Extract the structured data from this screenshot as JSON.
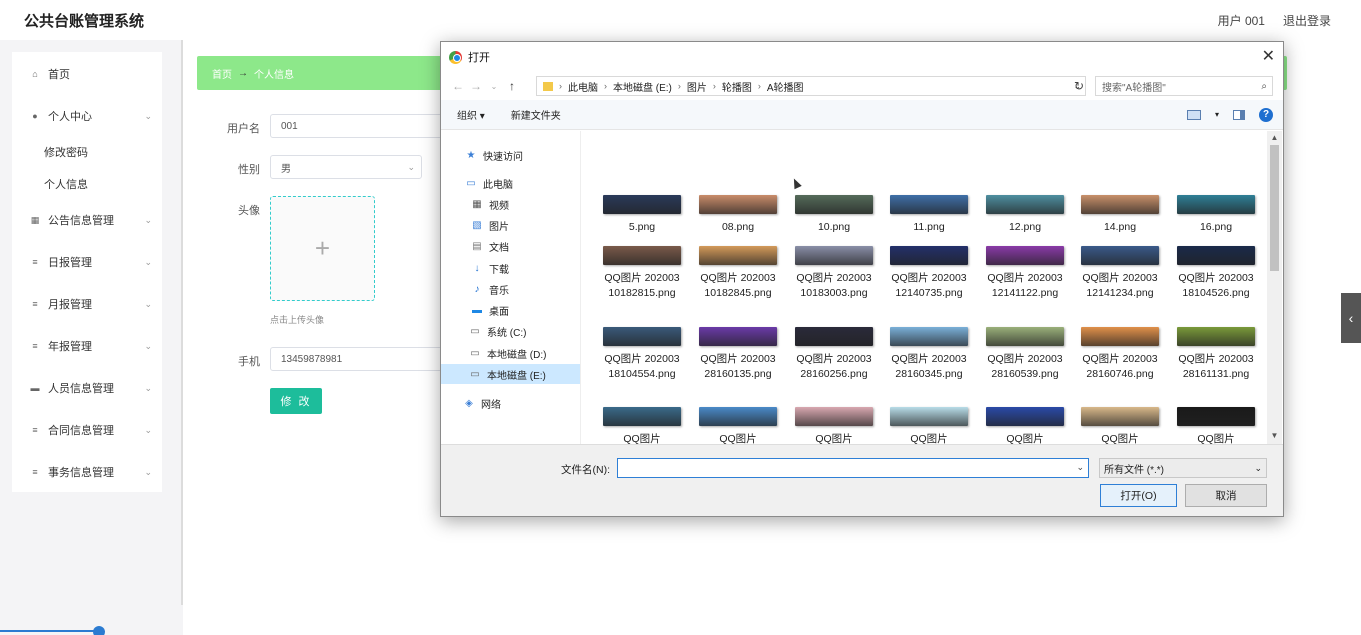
{
  "app": {
    "title": "公共台账管理系统",
    "user_label": "用户 001",
    "logout": "退出登录"
  },
  "sidebar": {
    "items": [
      {
        "label": "首页",
        "icon": "home-icon",
        "expandable": false
      },
      {
        "label": "个人中心",
        "icon": "user-icon",
        "expandable": true
      },
      {
        "label": "公告信息管理",
        "icon": "grid-icon",
        "expandable": true
      },
      {
        "label": "日报管理",
        "icon": "list-icon",
        "expandable": true
      },
      {
        "label": "月报管理",
        "icon": "list-icon",
        "expandable": true
      },
      {
        "label": "年报管理",
        "icon": "list-icon",
        "expandable": true
      },
      {
        "label": "人员信息管理",
        "icon": "monitor-icon",
        "expandable": true
      },
      {
        "label": "合同信息管理",
        "icon": "list-icon",
        "expandable": true
      },
      {
        "label": "事务信息管理",
        "icon": "list-icon",
        "expandable": true
      }
    ],
    "subitems": [
      "修改密码",
      "个人信息"
    ]
  },
  "breadcrumb": {
    "home": "首页",
    "current": "个人信息"
  },
  "form": {
    "username_label": "用户名",
    "username_value": "001",
    "gender_label": "性别",
    "gender_value": "男",
    "avatar_label": "头像",
    "avatar_hint": "点击上传头像",
    "phone_label": "手机",
    "phone_value": "13459878981",
    "submit_label": "修 改"
  },
  "dialog": {
    "title": "打开",
    "path": [
      "此电脑",
      "本地磁盘 (E:)",
      "图片",
      "轮播图",
      "A轮播图"
    ],
    "search_placeholder": "搜索\"A轮播图\"",
    "organize": "组织 ▾",
    "new_folder": "新建文件夹",
    "nav": [
      {
        "label": "快速访问",
        "icon": "star-icon"
      },
      {
        "label": "此电脑",
        "icon": "computer-icon"
      },
      {
        "label": "视频",
        "icon": "video-icon"
      },
      {
        "label": "图片",
        "icon": "picture-icon"
      },
      {
        "label": "文档",
        "icon": "document-icon"
      },
      {
        "label": "下载",
        "icon": "download-icon"
      },
      {
        "label": "音乐",
        "icon": "music-icon"
      },
      {
        "label": "桌面",
        "icon": "desktop-icon"
      },
      {
        "label": "系统 (C:)",
        "icon": "drive-icon"
      },
      {
        "label": "本地磁盘 (D:)",
        "icon": "drive-icon"
      },
      {
        "label": "本地磁盘 (E:)",
        "icon": "drive-icon",
        "selected": true
      },
      {
        "label": "网络",
        "icon": "network-icon"
      }
    ],
    "files": [
      {
        "name": "5.png",
        "color": "#2a3a5a"
      },
      {
        "name": "08.png",
        "color": "#c98c6a"
      },
      {
        "name": "10.png",
        "color": "#556b5a",
        "selected": true
      },
      {
        "name": "11.png",
        "color": "#3f6fa8"
      },
      {
        "name": "12.png",
        "color": "#4e8fa0"
      },
      {
        "name": "14.png",
        "color": "#c8906a"
      },
      {
        "name": "16.png",
        "color": "#2f7f96"
      },
      {
        "name": "QQ图片 20200310182815.png",
        "color": "#7a5a4a"
      },
      {
        "name": "QQ图片 20200310182845.png",
        "color": "#d39a5a"
      },
      {
        "name": "QQ图片 20200310183003.png",
        "color": "#8a8fa8"
      },
      {
        "name": "QQ图片 20200312140735.png",
        "color": "#23306a"
      },
      {
        "name": "QQ图片 20200312141122.png",
        "color": "#8a3aa8"
      },
      {
        "name": "QQ图片 20200312141234.png",
        "color": "#3a5a8a"
      },
      {
        "name": "QQ图片 20200318104526.png",
        "color": "#1a2a4a"
      },
      {
        "name": "QQ图片 20200318104554.png",
        "color": "#3a5a7a"
      },
      {
        "name": "QQ图片 20200328160135.png",
        "color": "#6a3aa8"
      },
      {
        "name": "QQ图片 20200328160256.png",
        "color": "#2a2a3a"
      },
      {
        "name": "QQ图片 20200328160345.png",
        "color": "#7ab0d8"
      },
      {
        "name": "QQ图片 20200328160539.png",
        "color": "#9ab07a"
      },
      {
        "name": "QQ图片 20200328160746.png",
        "color": "#e0904a"
      },
      {
        "name": "QQ图片 20200328161131.png",
        "color": "#7a9a3a"
      },
      {
        "name": "QQ图片",
        "color": "#3a6a8a"
      },
      {
        "name": "QQ图片",
        "color": "#4a8ac8"
      },
      {
        "name": "QQ图片",
        "color": "#d8a8b0"
      },
      {
        "name": "QQ图片",
        "color": "#b8dce8"
      },
      {
        "name": "QQ图片",
        "color": "#2a4aa8"
      },
      {
        "name": "QQ图片",
        "color": "#d8b88a"
      },
      {
        "name": "QQ图片",
        "color": "#1a1a1a"
      }
    ],
    "filename_label": "文件名(N):",
    "filename_value": "",
    "filetype": "所有文件 (*.*)",
    "open": "打开(O)",
    "cancel": "取消"
  }
}
